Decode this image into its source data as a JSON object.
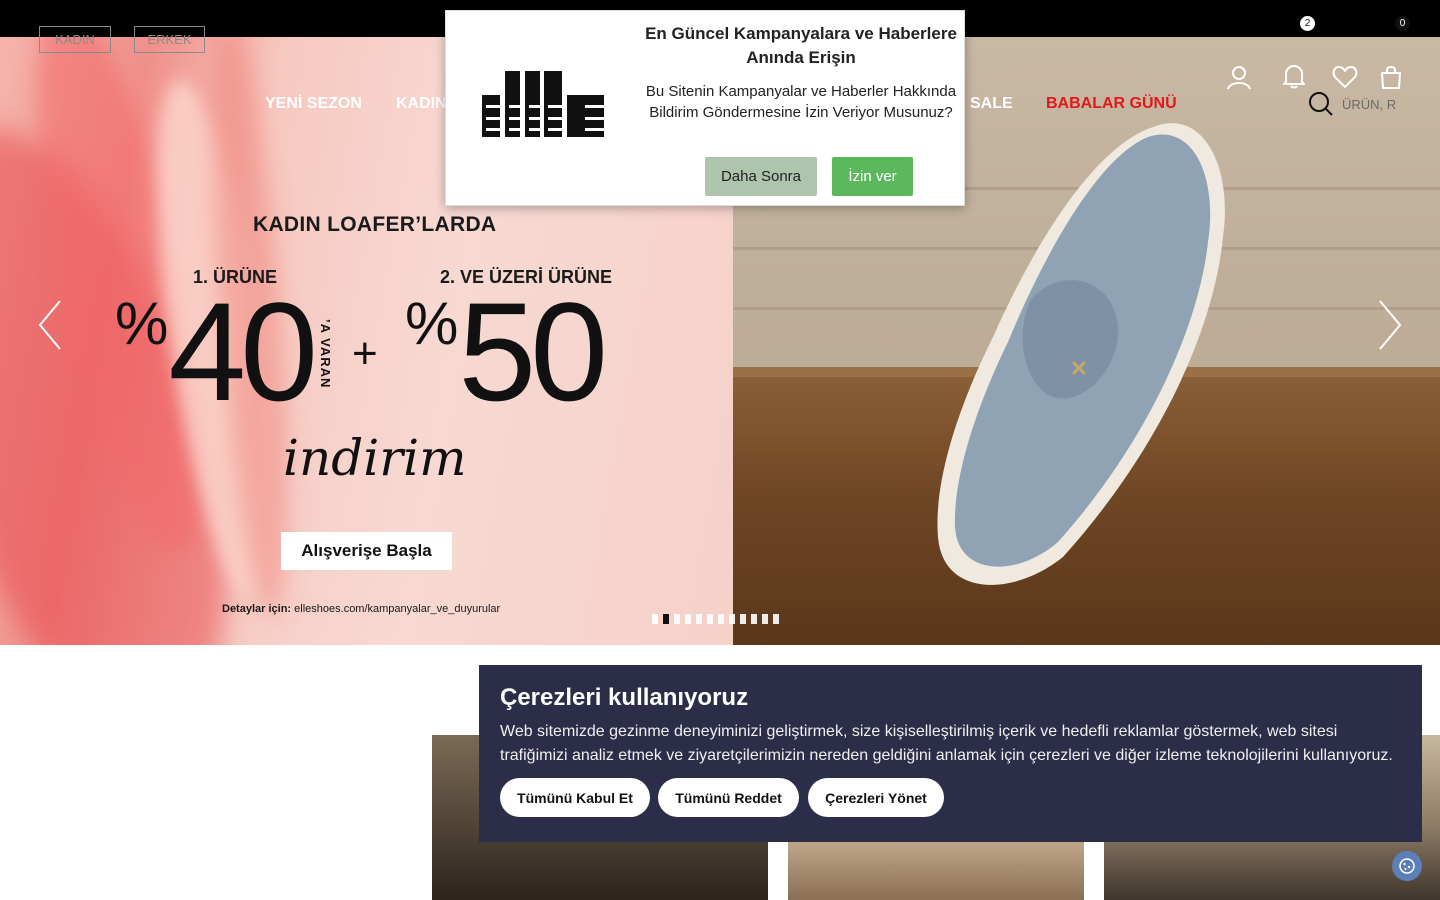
{
  "header": {
    "gender_tabs": [
      "KADIN",
      "ERKEK"
    ],
    "nav": [
      {
        "label": "YENİ SEZON",
        "color": "#ffffff"
      },
      {
        "label": "KADIN",
        "color": "#ffffff"
      },
      {
        "label": "SALE",
        "color": "#ffffff"
      },
      {
        "label": "BABALAR GÜNÜ",
        "color": "#e01919"
      }
    ],
    "notification_count": "2",
    "cart_count": "0",
    "search_placeholder": "ÜRÜN, R"
  },
  "hero": {
    "title": "KADIN LOAFER’LARDA",
    "sub1": "1. ÜRÜNE",
    "sub2": "2. VE ÜZERİ ÜRÜNE",
    "pct_sign": "%",
    "value1": "40",
    "varan": "’A VARAN",
    "plus": "+",
    "value2": "50",
    "indirim": "indirim",
    "button": "Alışverişe Başla",
    "details_label": "Detaylar için:",
    "details_url": "elleshoes.com/kampanyalar_ve_duyurular",
    "slide_count": 12,
    "active_slide": 2
  },
  "notification_modal": {
    "title": "En Güncel Kampanyalara ve Haberlere Anında Erişin",
    "text": "Bu Sitenin Kampanyalar ve Haberler Hakkında Bildirim Göndermesine İzin Veriyor Musunuz?",
    "later": "Daha Sonra",
    "allow": "İzin ver",
    "later_color": "#adc5ad",
    "allow_color": "#5cb85c"
  },
  "cookie_banner": {
    "title": "Çerezleri kullanıyoruz",
    "text": "Web sitemizde gezinme deneyiminizi geliştirmek, size kişiselleştirilmiş içerik ve hedefli reklamlar göstermek, web sitesi trafiğimizi analiz etmek ve ziyaretçilerimizin nereden geldiğini anlamak için çerezleri ve diğer izleme teknolojilerini kullanıyoruz.",
    "accept": "Tümünü Kabul Et",
    "reject": "Tümünü Reddet",
    "manage": "Çerezleri Yönet",
    "background": "#2c2d48"
  }
}
